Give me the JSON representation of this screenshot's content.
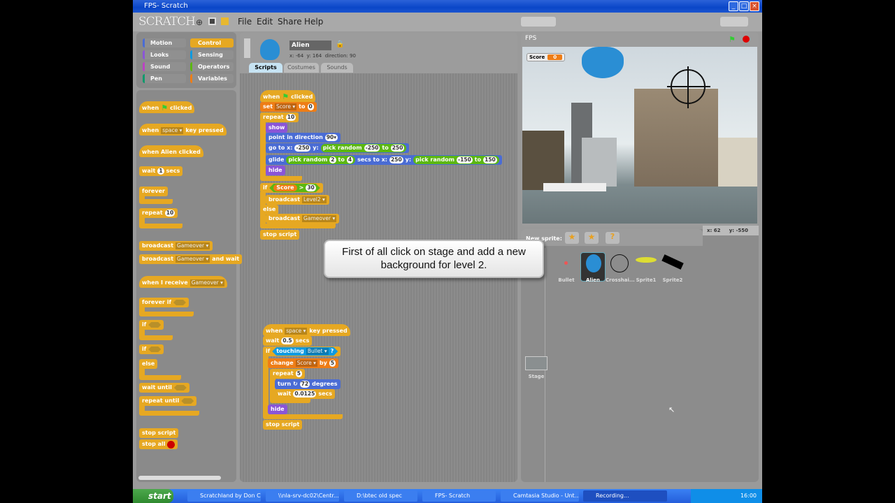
{
  "window": {
    "title": "FPS- Scratch",
    "logo": "SCRATCH",
    "menu": [
      "File",
      "Edit",
      "Share",
      "Help"
    ]
  },
  "categories": [
    {
      "label": "Motion",
      "color": "#4a6cd4"
    },
    {
      "label": "Control",
      "color": "#e6a822",
      "active": true
    },
    {
      "label": "Looks",
      "color": "#8a55d7"
    },
    {
      "label": "Sensing",
      "color": "#0e9ae0"
    },
    {
      "label": "Sound",
      "color": "#bb42c3"
    },
    {
      "label": "Operators",
      "color": "#5cb712"
    },
    {
      "label": "Pen",
      "color": "#0e9a6c"
    },
    {
      "label": "Variables",
      "color": "#ee7d16"
    }
  ],
  "colors": {
    "control": "#e6a822",
    "motion": "#4a6cd4",
    "looks": "#8a55d7",
    "variables": "#ee7d16",
    "operators": "#5cb712",
    "sensing": "#0e9ae0"
  },
  "sprite": {
    "name": "Alien",
    "x_label": "x:",
    "x": "-64",
    "y_label": "y:",
    "y": "164",
    "direction_label": "direction:",
    "direction": "90"
  },
  "tabs": [
    "Scripts",
    "Costumes",
    "Sounds"
  ],
  "palette": [
    [
      "when",
      "FLAG",
      "clicked"
    ],
    [
      "when",
      {
        "d": "space"
      },
      "key pressed"
    ],
    [
      "when Alien clicked"
    ],
    [
      "wait",
      {
        "v": "1"
      },
      "secs"
    ],
    [
      "forever"
    ],
    [
      "repeat",
      {
        "v": "10"
      }
    ],
    [
      "broadcast",
      {
        "d": "Gameover"
      }
    ],
    [
      "broadcast",
      {
        "d": "Gameover"
      },
      "and wait"
    ],
    [
      "when I receive",
      {
        "d": "Gameover"
      }
    ],
    [
      "forever if",
      "HEX"
    ],
    [
      "if",
      "HEX"
    ],
    [
      "if",
      "HEX"
    ],
    [
      "else"
    ],
    [
      "wait until",
      "HEX"
    ],
    [
      "repeat until",
      "HEX"
    ],
    [
      "stop script"
    ],
    [
      "stop all",
      "STOP"
    ]
  ],
  "script1": [
    [
      "when",
      "FLAG",
      "clicked"
    ],
    [
      "set",
      {
        "d": "Score"
      },
      "to",
      {
        "v": "0"
      }
    ],
    [
      "repeat",
      {
        "v": "10"
      }
    ],
    [
      "show"
    ],
    [
      "point in direction",
      {
        "v": "90▾"
      }
    ],
    [
      "go to x:",
      {
        "v": "-250"
      },
      "y:",
      {
        "r": [
          "pick random",
          {
            "v": "-250"
          },
          "to",
          {
            "v": "250"
          }
        ]
      }
    ],
    [
      "glide",
      {
        "r": [
          "pick random",
          {
            "v": "2"
          },
          "to",
          {
            "v": "4"
          }
        ]
      },
      "secs to x:",
      {
        "v": "250"
      },
      "y:",
      {
        "r": [
          "pick random",
          {
            "v": "-150"
          },
          "to",
          {
            "v": "150"
          }
        ]
      }
    ],
    [
      "hide"
    ],
    [
      "if",
      {
        "c": [
          {
            "var": "Score"
          },
          ">",
          {
            "v": "30"
          }
        ]
      }
    ],
    [
      "broadcast",
      {
        "d": "Level2"
      }
    ],
    [
      "else"
    ],
    [
      "broadcast",
      {
        "d": "Gameover"
      }
    ],
    [
      "stop script"
    ]
  ],
  "script2": [
    [
      "when",
      {
        "d": "space"
      },
      "key pressed"
    ],
    [
      "wait",
      {
        "v": "0.5"
      },
      "secs"
    ],
    [
      "if",
      {
        "s": [
          "touching",
          {
            "d": "Bullet"
          },
          "?"
        ]
      }
    ],
    [
      "change",
      {
        "d": "Score"
      },
      "by",
      {
        "v": "5"
      }
    ],
    [
      "repeat",
      {
        "v": "5"
      }
    ],
    [
      "turn ↻",
      {
        "v": "72"
      },
      "degrees"
    ],
    [
      "wait",
      {
        "v": "0.0125"
      },
      "secs"
    ],
    [
      "hide"
    ],
    [
      "stop script"
    ]
  ],
  "callout": "First of all click on stage and add a new background for level 2.",
  "stage": {
    "title": "FPS",
    "score_label": "Score",
    "score_value": "0",
    "mouse_x_label": "x:",
    "mouse_x": "62",
    "mouse_y_label": "y:",
    "mouse_y": "-550"
  },
  "sprites": {
    "new_sprite_label": "New sprite:",
    "items": [
      "Bullet",
      "Alien",
      "Crosshai...",
      "Sprite1",
      "Sprite2"
    ],
    "selected": "Alien",
    "stage_label": "Stage"
  },
  "taskbar": {
    "start": "start",
    "items": [
      "Scratchland by Don C...",
      "\\\\nla-srv-dc02\\Centr...",
      "D:\\btec old spec",
      "FPS- Scratch",
      "Camtasia Studio - Unt...",
      "Recording..."
    ],
    "clock": "16:00"
  }
}
